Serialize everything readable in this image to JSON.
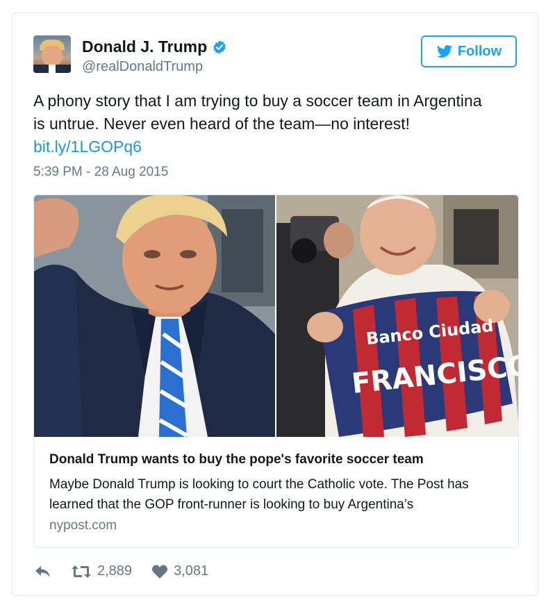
{
  "colors": {
    "accent": "#1da1f2",
    "link": "#1b95e0",
    "muted": "#657786",
    "text": "#14171a",
    "border": "#e1e8ed"
  },
  "user": {
    "name": "Donald J. Trump",
    "handle": "@realDonaldTrump",
    "verified_icon": "verified-badge-icon"
  },
  "follow_label": "Follow",
  "tweet": {
    "text_line1": "A phony story that I am trying to buy a soccer team in Argentina",
    "text_line2": "is untrue. Never even heard of the team—no interest!",
    "link": "bit.ly/1LGOPq6",
    "timestamp": "5:39 PM - 28 Aug 2015"
  },
  "card": {
    "jersey_text_top": "Banco Ciudad",
    "jersey_text_bottom": "FRANCISCO",
    "title": "Donald Trump wants to buy the pope's favorite soccer team",
    "description": "Maybe Donald Trump is looking to court the Catholic vote. The Post has learned that the GOP front-runner is looking to buy Argentina’s",
    "domain": "nypost.com"
  },
  "actions": {
    "reply_icon": "reply-icon",
    "retweet_icon": "retweet-icon",
    "retweet_count": "2,889",
    "like_icon": "heart-icon",
    "like_count": "3,081"
  }
}
